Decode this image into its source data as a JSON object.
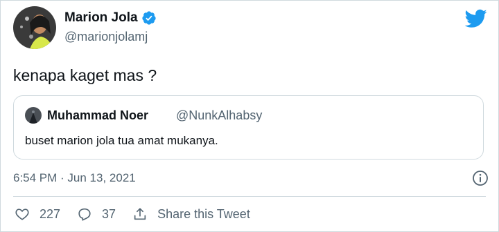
{
  "author": {
    "display_name": "Marion Jola",
    "handle": "@marionjolamj",
    "verified": true
  },
  "tweet": {
    "text": "kenapa kaget mas ?",
    "timestamp": "6:54 PM · Jun 13, 2021"
  },
  "quoted_tweet": {
    "display_name": "Muhammad Noer",
    "handle": "@NunkAlhabsy",
    "text": "buset marion jola tua amat mukanya."
  },
  "actions": {
    "like_count": "227",
    "reply_count": "37",
    "share_label": "Share this Tweet"
  },
  "icons": {
    "brand": "twitter-bird-icon",
    "verified": "verified-badge-icon",
    "like": "heart-icon",
    "reply": "reply-icon",
    "share": "share-icon",
    "info": "info-icon"
  },
  "colors": {
    "brand_blue": "#1d9bf0",
    "text_primary": "#0f1419",
    "text_secondary": "#536471",
    "border": "#cfd9de"
  }
}
